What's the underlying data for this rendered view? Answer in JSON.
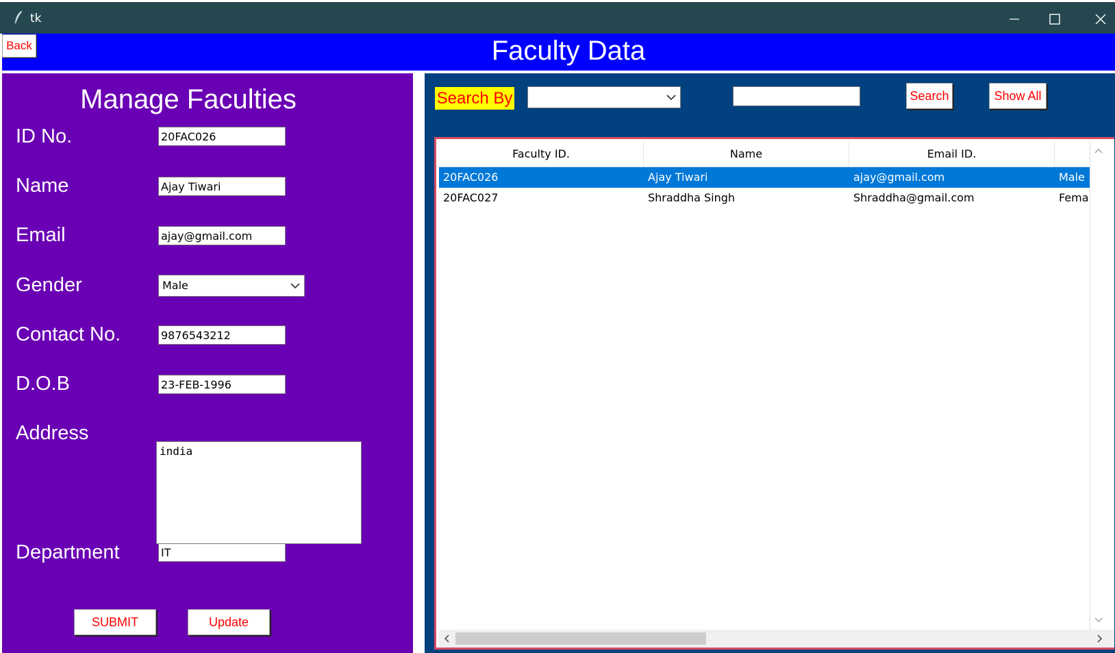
{
  "window": {
    "title": "tk"
  },
  "header": {
    "back_label": "Back",
    "title": "Faculty Data"
  },
  "form": {
    "title": "Manage Faculties",
    "fields": {
      "id": {
        "label": "ID No.",
        "value": "20FAC026"
      },
      "name": {
        "label": "Name",
        "value": "Ajay Tiwari"
      },
      "email": {
        "label": "Email",
        "value": "ajay@gmail.com"
      },
      "gender": {
        "label": "Gender",
        "value": "Male"
      },
      "contact": {
        "label": "Contact No.",
        "value": "9876543212"
      },
      "dob": {
        "label": "D.O.B",
        "value": "23-FEB-1996"
      },
      "address": {
        "label": "Address",
        "value": "india"
      },
      "department": {
        "label": "Department",
        "value": "IT"
      }
    },
    "submit_label": "SUBMIT",
    "update_label": "Update"
  },
  "search": {
    "label": "Search By",
    "by_value": "",
    "query": "",
    "search_label": "Search",
    "show_all_label": "Show All"
  },
  "table": {
    "columns": [
      "Faculty ID.",
      "Name",
      "Email ID.",
      ""
    ],
    "rows": [
      [
        "20FAC026",
        "Ajay Tiwari",
        "ajay@gmail.com",
        "Male"
      ],
      [
        "20FAC027",
        "Shraddha Singh",
        "Shraddha@gmail.com",
        "Fema"
      ]
    ],
    "selected_row": 0
  },
  "colors": {
    "header_blue": "#0000ff",
    "left_panel": "#6a00b4",
    "right_panel": "#01417f",
    "accent_red": "#ff0000",
    "highlight_yellow": "#ffff00",
    "selection": "#0078d7",
    "frame_red": "#d84c63"
  }
}
